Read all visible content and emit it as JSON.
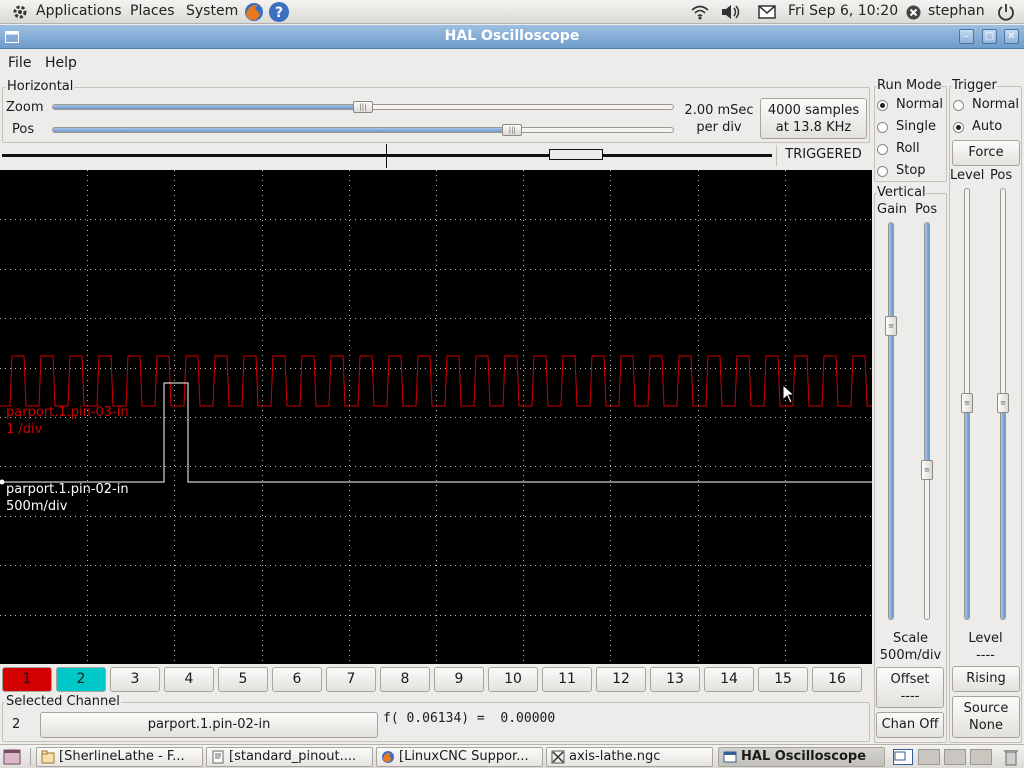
{
  "top_panel": {
    "menus": [
      "Applications",
      "Places",
      "System"
    ],
    "clock": "Fri Sep  6, 10:20",
    "user": "stephan"
  },
  "window": {
    "title": "HAL Oscilloscope",
    "menu": [
      "File",
      "Help"
    ]
  },
  "horizontal": {
    "frame_label": "Horizontal",
    "zoom_label": "Zoom",
    "pos_label": "Pos",
    "zoom_level": 0.5,
    "pos_level": 0.74,
    "rate_line1": "2.00 mSec",
    "rate_line2": "per div",
    "samples_line1": "4000 samples",
    "samples_line2": "at 13.8 KHz",
    "status": "TRIGGERED"
  },
  "run_mode": {
    "label": "Run Mode",
    "options": [
      "Normal",
      "Single",
      "Roll",
      "Stop"
    ],
    "selected": "Normal"
  },
  "trigger": {
    "label": "Trigger",
    "options": [
      "Normal",
      "Auto"
    ],
    "selected": "Auto",
    "force_label": "Force",
    "level_label": "Level",
    "pos_label": "Pos",
    "level_heading": "Level",
    "level_value": "----",
    "edge_button": "Rising",
    "source_line1": "Source",
    "source_line2": "None"
  },
  "vertical": {
    "label": "Vertical",
    "gain_label": "Gain",
    "pos_label": "Pos",
    "scale_label": "Scale",
    "scale_value": "500m/div",
    "offset_label": "Offset",
    "offset_value": "----",
    "chan_off": "Chan Off"
  },
  "traces": [
    {
      "name": "parport.1.pin-03-in",
      "scale": "1 /div",
      "color": "#d20000"
    },
    {
      "name": "parport.1.pin-02-in",
      "scale": "500m/div",
      "color": "#ffffff"
    }
  ],
  "channels": {
    "buttons": [
      "1",
      "2",
      "3",
      "4",
      "5",
      "6",
      "7",
      "8",
      "9",
      "10",
      "11",
      "12",
      "13",
      "14",
      "15",
      "16"
    ],
    "ch1_color": "#d20000",
    "ch2_color": "#00c8c8"
  },
  "selected_channel": {
    "label": "Selected Channel",
    "number": "2",
    "name": "parport.1.pin-02-in",
    "readout": "f( 0.06134) =  0.00000"
  },
  "taskbar": {
    "tasks": [
      "[SherlineLathe - F...",
      "[standard_pinout....",
      "[LinuxCNC Suppor...",
      "axis-lathe.ngc",
      "HAL Oscilloscope"
    ]
  }
}
